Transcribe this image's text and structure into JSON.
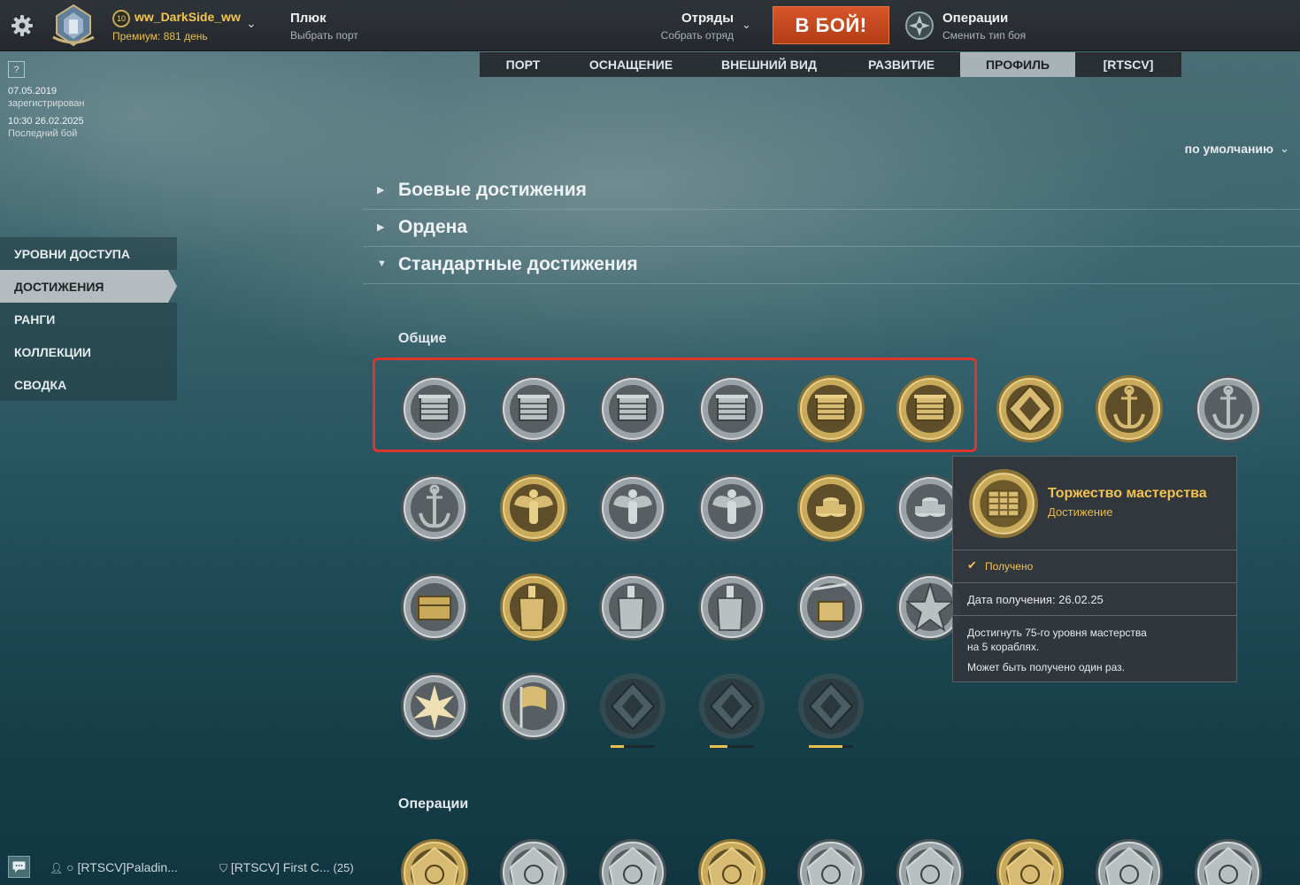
{
  "topbar": {
    "username": "ww_DarkSide_ww",
    "level": "10",
    "premium": "Премиум: 881 день",
    "ship_name": "Плюк",
    "ship_sub": "Выбрать порт",
    "squad_title": "Отряды",
    "squad_sub": "Собрать отряд",
    "battle_label": "В БОЙ!",
    "ops_title": "Операции",
    "ops_sub": "Сменить тип боя"
  },
  "tabs": [
    {
      "label": "ПОРТ",
      "active": false
    },
    {
      "label": "ОСНАЩЕНИЕ",
      "active": false
    },
    {
      "label": "ВНЕШНИЙ ВИД",
      "active": false
    },
    {
      "label": "РАЗВИТИЕ",
      "active": false
    },
    {
      "label": "ПРОФИЛЬ",
      "active": true
    },
    {
      "label": "[RTSCV]",
      "active": false
    }
  ],
  "profile": {
    "help": "?",
    "registered_date": "07.05.2019",
    "registered_label": "зарегистрирован",
    "last_battle": "10:30  26.02.2025",
    "last_battle_label": "Последний бой"
  },
  "side_nav": [
    {
      "label": "УРОВНИ ДОСТУПА",
      "active": false
    },
    {
      "label": "ДОСТИЖЕНИЯ",
      "active": true
    },
    {
      "label": "РАНГИ",
      "active": false
    },
    {
      "label": "КОЛЛЕКЦИИ",
      "active": false
    },
    {
      "label": "СВОДКА",
      "active": false
    }
  ],
  "sort_label": "по умолчанию",
  "sections": [
    {
      "label": "Боевые достижения",
      "expanded": false
    },
    {
      "label": "Ордена",
      "expanded": false
    },
    {
      "label": "Стандартные достижения",
      "expanded": true
    }
  ],
  "groups": {
    "general": "Общие",
    "operations": "Операции"
  },
  "medals": [
    {
      "kind": "ribbon",
      "tone": "silver"
    },
    {
      "kind": "ribbon",
      "tone": "silver"
    },
    {
      "kind": "ribbon",
      "tone": "silver"
    },
    {
      "kind": "ribbon",
      "tone": "silver"
    },
    {
      "kind": "ribbon",
      "tone": "gold"
    },
    {
      "kind": "ribbon",
      "tone": "gold"
    },
    {
      "kind": "diamond",
      "tone": "gold"
    },
    {
      "kind": "anchor",
      "tone": "gold"
    },
    {
      "kind": "anchor",
      "tone": "silver"
    },
    {
      "kind": "anchor",
      "tone": "silver"
    },
    {
      "kind": "angel",
      "tone": "gold"
    },
    {
      "kind": "angel",
      "tone": "silver"
    },
    {
      "kind": "angel",
      "tone": "silver"
    },
    {
      "kind": "coins",
      "tone": "gold"
    },
    {
      "kind": "coins",
      "tone": "silver"
    },
    {
      "kind": "crate",
      "tone": "silver"
    },
    {
      "kind": "ship",
      "tone": "gold"
    },
    {
      "kind": "ship",
      "tone": "silver"
    },
    {
      "kind": "ship",
      "tone": "silver"
    },
    {
      "kind": "cargo",
      "tone": "silver"
    },
    {
      "kind": "star",
      "tone": "silver"
    },
    {
      "kind": "blast",
      "tone": "silver"
    },
    {
      "kind": "flag",
      "tone": "silver"
    },
    {
      "kind": "diamond",
      "tone": "dark",
      "progress": 0.3
    },
    {
      "kind": "diamond",
      "tone": "dark",
      "progress": 0.4
    },
    {
      "kind": "diamond",
      "tone": "dark",
      "progress": 0.75
    },
    {
      "kind": "operation",
      "tone": "gold"
    },
    {
      "kind": "operation",
      "tone": "silver"
    },
    {
      "kind": "operation",
      "tone": "silver"
    },
    {
      "kind": "operation",
      "tone": "gold"
    },
    {
      "kind": "operation",
      "tone": "silver"
    },
    {
      "kind": "operation",
      "tone": "silver"
    },
    {
      "kind": "operation",
      "tone": "gold"
    },
    {
      "kind": "operation",
      "tone": "silver"
    },
    {
      "kind": "operation",
      "tone": "silver"
    }
  ],
  "tooltip": {
    "title": "Торжество мастерства",
    "subtitle": "Достижение",
    "status": "Получено",
    "date": "Дата получения: 26.02.25",
    "description_line1": "Достигнуть 75-го уровня мастерства",
    "description_line2": "на 5 кораблях.",
    "once": "Может быть получено один раз."
  },
  "bottom": {
    "user": "○ [RTSCV]Paladin...",
    "clan": "[RTSCV] First C...",
    "clan_count": "(25)"
  },
  "colors": {
    "accent_gold": "#f2c24e",
    "battle_button": "#c9461c",
    "highlight": "#e0352c"
  }
}
